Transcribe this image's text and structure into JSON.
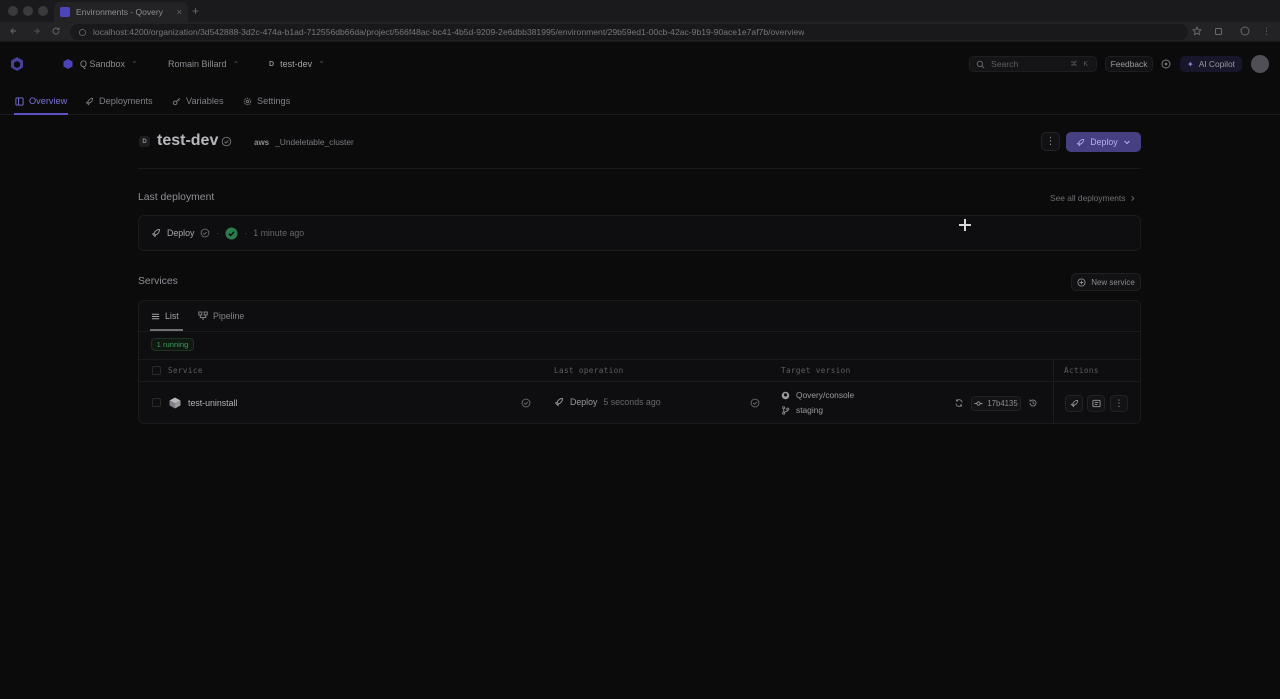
{
  "browser": {
    "tab_title": "Environments - Qovery",
    "url": "localhost:4200/organization/3d542888-3d2c-474a-b1ad-712556db66da/project/566f48ac-bc41-4b5d-9209-2e6dbb381995/environment/29b59ed1-00cb-42ac-9b19-90ace1e7af7b/overview"
  },
  "header": {
    "organization": "Q Sandbox",
    "project": "Romain Billard",
    "environment_badge": "D",
    "environment": "test-dev",
    "search_placeholder": "Search",
    "search_shortcut": "⌘ K",
    "feedback_label": "Feedback",
    "copilot_label": "AI Copilot"
  },
  "nav": {
    "tabs": [
      {
        "label": "Overview",
        "icon": "overview-icon",
        "active": true
      },
      {
        "label": "Deployments",
        "icon": "rocket-icon",
        "active": false
      },
      {
        "label": "Variables",
        "icon": "variables-icon",
        "active": false
      },
      {
        "label": "Settings",
        "icon": "gear-icon",
        "active": false
      }
    ]
  },
  "environment": {
    "badge": "D",
    "name": "test-dev",
    "cloud_provider": "aws",
    "cluster": "_Undeletable_cluster",
    "deploy_label": "Deploy"
  },
  "last_deployment": {
    "title": "Last deployment",
    "see_all_label": "See all deployments",
    "action": "Deploy",
    "time": "1 minute ago"
  },
  "services": {
    "title": "Services",
    "new_service_label": "New service",
    "tabs": [
      {
        "label": "List",
        "active": true
      },
      {
        "label": "Pipeline",
        "active": false
      }
    ],
    "running_badge": "1 running",
    "columns": [
      "Service",
      "Last operation",
      "Target version",
      "Actions"
    ],
    "rows": [
      {
        "name": "test-uninstall",
        "operation": "Deploy",
        "operation_time": "5 seconds ago",
        "repository": "Qovery/console",
        "branch": "staging",
        "commit": "17b4135"
      }
    ]
  },
  "colors": {
    "accent": "#5b53c5",
    "success": "#3d9c5e",
    "background": "#0b0b0c"
  }
}
